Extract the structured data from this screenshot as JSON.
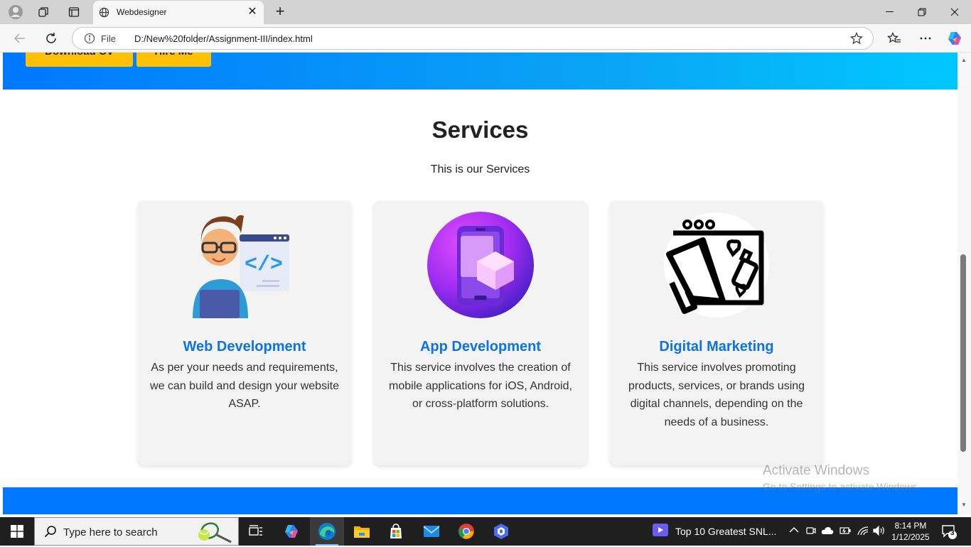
{
  "browser": {
    "tab_title": "Webdesigner",
    "address_scheme": "File",
    "address_url": "D:/New%20folder/Assignment-III/index.html"
  },
  "hero": {
    "buttons": [
      "Download CV",
      "Hire Me"
    ]
  },
  "services": {
    "title": "Services",
    "subtitle": "This is our Services",
    "cards": [
      {
        "title": "Web Development",
        "description": "As per your needs and requirements, we can build and design your website ASAP."
      },
      {
        "title": "App Development",
        "description": "This service involves the creation of mobile applications for iOS, Android, or cross-platform solutions."
      },
      {
        "title": "Digital Marketing",
        "description": "This service involves promoting products, services, or brands using digital channels, depending on the needs of a business."
      }
    ]
  },
  "watermark": {
    "line1": "Activate Windows",
    "line2": "Go to Settings to activate Windows."
  },
  "taskbar": {
    "search_placeholder": "Type here to search",
    "news_text": "Top 10 Greatest SNL...",
    "time": "8:14 PM",
    "date": "1/12/2025",
    "notification_count": "3"
  },
  "colors": {
    "accent_blue": "#0078ff",
    "button_yellow": "#ffc107",
    "card_title": "#0a74e6"
  }
}
